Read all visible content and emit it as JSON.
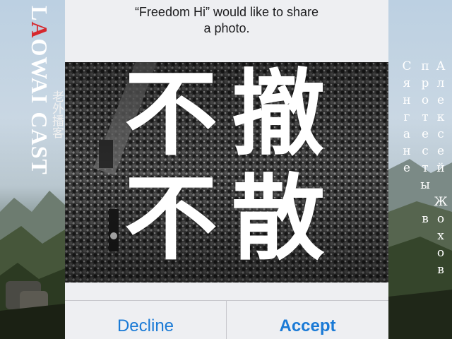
{
  "alert": {
    "title_line1": "“Freedom Hi” would like to share",
    "title_line2": "a photo.",
    "decline_label": "Decline",
    "accept_label": "Accept",
    "button_color": "#1a7ad6"
  },
  "photo": {
    "top_left_char": "不",
    "top_right_char": "撤",
    "bottom_left_char": "不",
    "bottom_right_char": "散"
  },
  "branding": {
    "logo_latin_1": "LAOWAI",
    "logo_latin_2": "CAST",
    "logo_chinese": "老外播客",
    "accent_color": "#d6282e"
  },
  "overlay_text": {
    "col1": "Алексей Жохов",
    "col2": "протесты в",
    "col3": "Сянгане"
  }
}
